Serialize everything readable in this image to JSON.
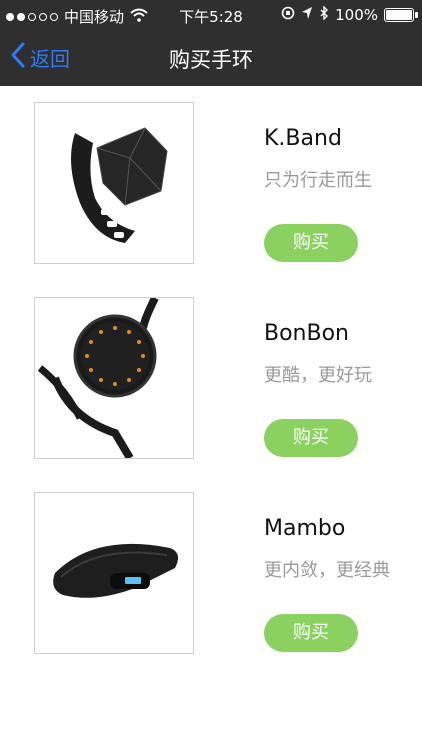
{
  "status": {
    "carrier": "中国移动",
    "time": "下午5:28",
    "battery": "100%"
  },
  "nav": {
    "back_label": "返回",
    "title": "购买手环"
  },
  "products": [
    {
      "name": "K.Band",
      "tagline": "只为行走而生",
      "buy_label": "购买"
    },
    {
      "name": "BonBon",
      "tagline": "更酷，更好玩",
      "buy_label": "购买"
    },
    {
      "name": "Mambo",
      "tagline": "更内敛，更经典",
      "buy_label": "购买"
    }
  ],
  "colors": {
    "accent": "#2f7bf6",
    "buy_button": "#8ad160",
    "header_bg": "#2f2f2f"
  }
}
